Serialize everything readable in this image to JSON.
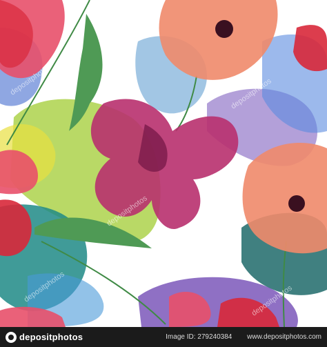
{
  "artwork": {
    "description_icon": "watercolor-poppy-pattern",
    "watermark_text": "depositphotos",
    "colors": {
      "petal_pink": "#e8506a",
      "petal_magenta": "#b8306e",
      "petal_peach": "#f08a6a",
      "petal_red": "#d8283a",
      "leaf_green": "#4f9a55",
      "splash_blue": "#6a9ad8",
      "splash_teal": "#1f8a86",
      "splash_yellow_green": "#b8d838",
      "splash_purple": "#7050b8",
      "flower_center": "#3a1020"
    }
  },
  "footer": {
    "logo_text": "depositphotos",
    "image_id": "Image ID: 279240384",
    "site": "www.depositphotos.com"
  }
}
